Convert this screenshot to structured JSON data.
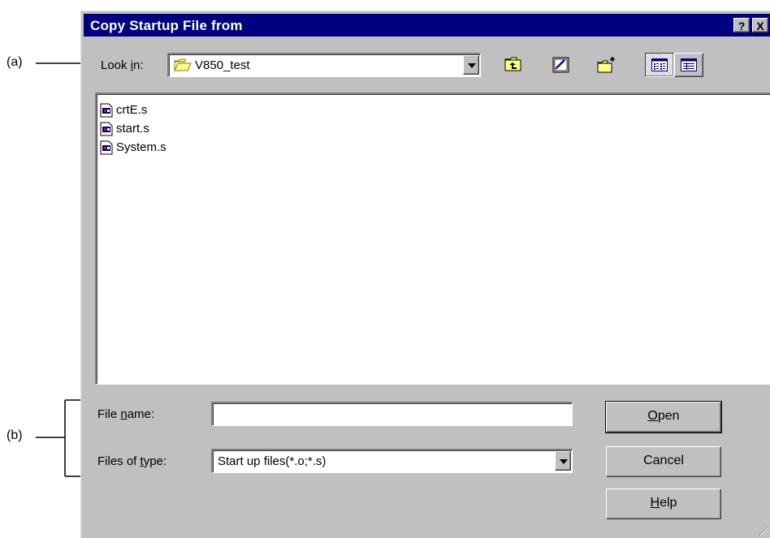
{
  "annotations": {
    "a_label": "(a)",
    "b_label": "(b)"
  },
  "dialog": {
    "title": "Copy Startup File from",
    "help_button": "?",
    "close_button": "X"
  },
  "look_in": {
    "label_pre": "Look ",
    "label_accel": "i",
    "label_post": "n:",
    "value": "V850_test",
    "icon": "open-folder-icon"
  },
  "toolbar": {
    "buttons": [
      {
        "name": "up-one-level",
        "icon": "folder-up-icon"
      },
      {
        "name": "desktop",
        "icon": "desktop-icon"
      },
      {
        "name": "new-folder",
        "icon": "new-folder-icon"
      },
      {
        "name": "list-view",
        "icon": "list-view-icon",
        "pressed": true
      },
      {
        "name": "details-view",
        "icon": "details-view-icon"
      }
    ]
  },
  "files": [
    {
      "name": "crtE.s",
      "icon": "asm-file-icon"
    },
    {
      "name": "start.s",
      "icon": "asm-file-icon"
    },
    {
      "name": "System.s",
      "icon": "asm-file-icon"
    }
  ],
  "file_name": {
    "label_pre": "File ",
    "label_accel": "n",
    "label_post": "ame:",
    "value": ""
  },
  "file_type": {
    "label_pre": "Files of ",
    "label_accel": "t",
    "label_post": "ype:",
    "value": "Start up files(*.o;*.s)"
  },
  "buttons": {
    "open_accel": "O",
    "open_rest": "pen",
    "cancel": "Cancel",
    "help_accel": "H",
    "help_rest": "elp"
  },
  "colors": {
    "titlebar": "#000080",
    "face": "#c0c0c0",
    "folder": "#ffff80"
  }
}
